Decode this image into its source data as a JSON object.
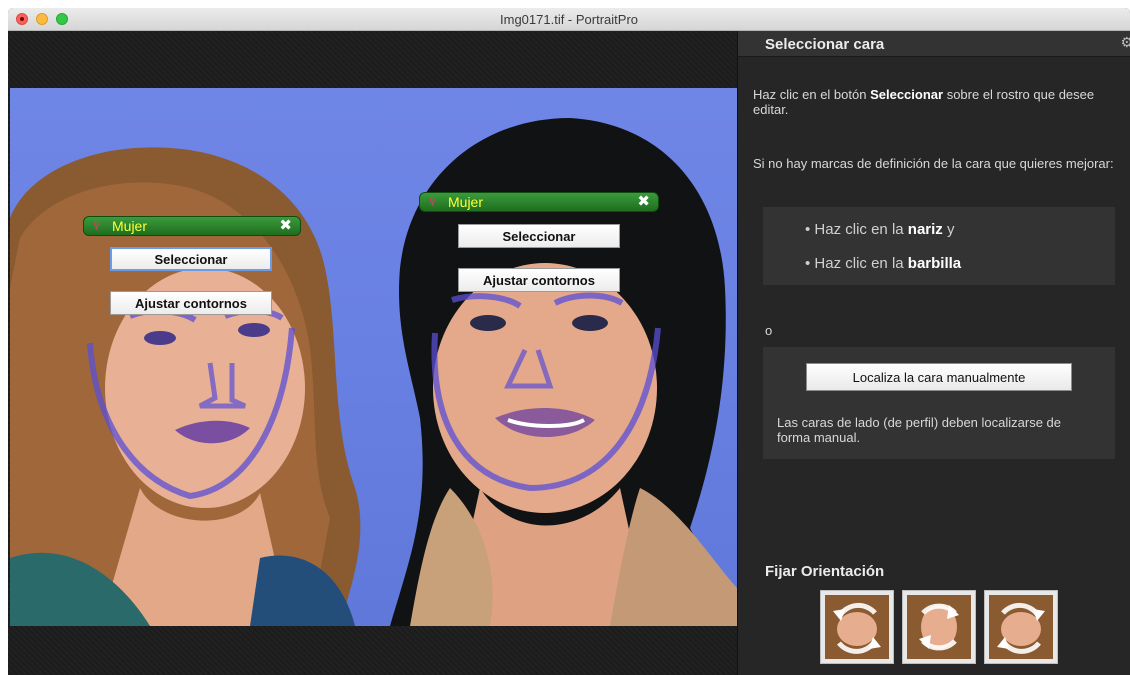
{
  "window": {
    "title": "Img0171.tif - PortraitPro"
  },
  "faces": [
    {
      "gender_icon": "female-symbol-icon",
      "tag_label": "Mujer",
      "select_label": "Seleccionar",
      "adjust_label": "Ajustar contornos"
    },
    {
      "gender_icon": "female-symbol-icon",
      "tag_label": "Mujer",
      "select_label": "Seleccionar",
      "adjust_label": "Ajustar contornos"
    }
  ],
  "panel": {
    "title": "Seleccionar cara",
    "intro": {
      "pre": "Haz clic en el botón ",
      "bold": "Seleccionar",
      "post": " sobre el rostro que desee editar."
    },
    "no_marks_text": "Si no hay marcas de definición de la cara que quieres mejorar:",
    "steps": [
      {
        "pre": "• Haz clic en la ",
        "bold": "nariz",
        "post": " y"
      },
      {
        "pre": "• Haz clic en la ",
        "bold": "barbilla",
        "post": ""
      }
    ],
    "or_text": "o",
    "locate_button": "Localiza la cara manualmente",
    "profile_note": "Las caras de lado (de perfil) deben localizarse de forma manual.",
    "orientation_title": "Fijar Orientación",
    "orientation_buttons": [
      "rotate-left-icon",
      "rotate-180-icon",
      "rotate-right-icon"
    ]
  },
  "colors": {
    "face_tag_green": "#2a8a2a",
    "face_tag_text": "#ffff33",
    "gender_symbol": "#e63a6e",
    "contour_lines": "#5b4fd6",
    "backdrop_blue": "#6a82e4",
    "panel_bg": "#262626"
  }
}
